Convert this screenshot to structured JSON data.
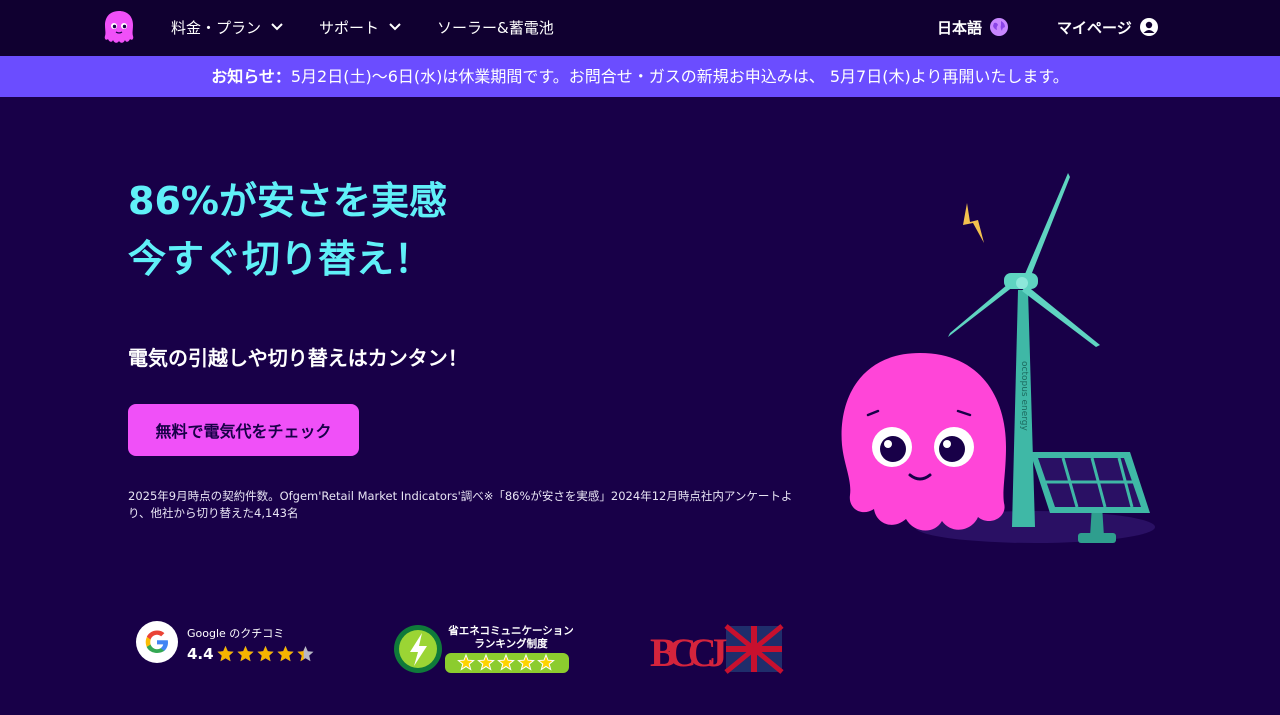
{
  "nav": {
    "items": [
      {
        "label": "料金・プラン",
        "has_dropdown": true
      },
      {
        "label": "サポート",
        "has_dropdown": true
      },
      {
        "label": "ソーラー&蓄電池",
        "has_dropdown": false
      }
    ],
    "language_label": "日本語",
    "mypage_label": "マイページ"
  },
  "banner": {
    "prefix": "お知らせ：",
    "message": "5月2日(土)〜6日(水)は休業期間です。お問合せ・ガスの新規お申込みは、 5月7日(木)より再開いたします。"
  },
  "hero": {
    "title_line1": "86%が安さを実感",
    "title_line2": "今すぐ切り替え！",
    "subtitle": "電気の引越しや切り替えはカンタン！",
    "cta_label": "無料で電気代をチェック",
    "footnote": "2025年9月時点の契約件数。Ofgem'Retail Market Indicators'調べ※「86%が安さを実感」2024年12月時点社内アンケートより、他社から切り替えた4,143名",
    "turbine_text": "octopus energy"
  },
  "badges": {
    "google_label": "Google のクチコミ",
    "google_score": "4.4",
    "google_rating": 4.4,
    "energy_award_line1": "省エネコミュニケーション",
    "energy_award_line2": "ランキング制度",
    "energy_award_stars": 5,
    "bcj_text": "BCCJ"
  },
  "colors": {
    "background": "#180048",
    "nav_background": "#100030",
    "banner": "#6b4dff",
    "accent_cyan": "#60f0f8",
    "cta_pink": "#f050f8",
    "star_gold": "#f5b400"
  }
}
